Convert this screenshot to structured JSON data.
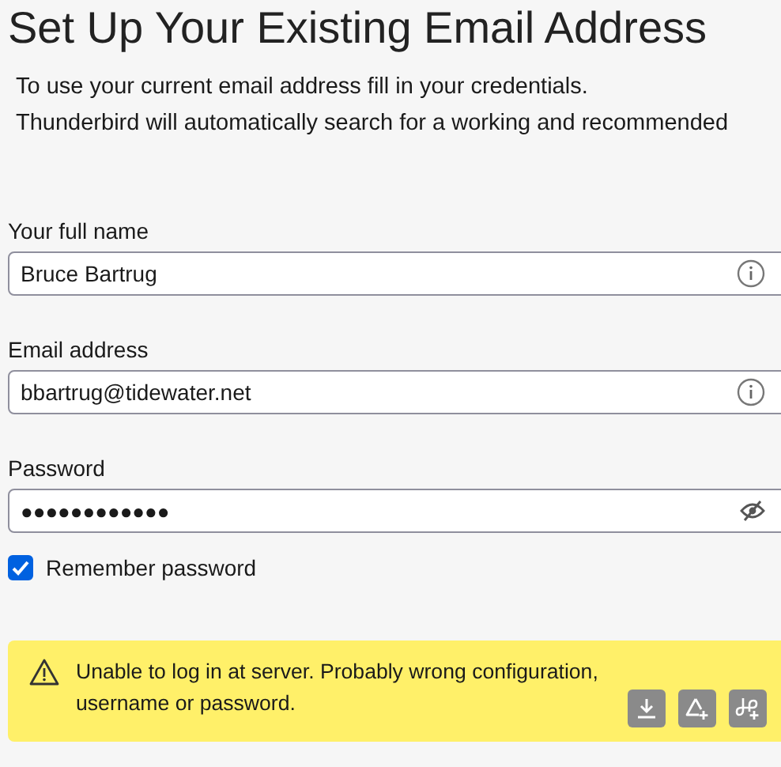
{
  "title": "Set Up Your Existing Email Address",
  "intro": [
    "To use your current email address fill in your credentials.",
    "Thunderbird will automatically search for a working and recommended"
  ],
  "fields": [
    {
      "label": "Your full name",
      "value": "Bruce Bartrug",
      "kind": "info"
    },
    {
      "label": "Email address",
      "value": "bbartrug@tidewater.net",
      "kind": "info"
    },
    {
      "label": "Password",
      "value": "●●●●●●●●●●●●",
      "kind": "password"
    }
  ],
  "remember": {
    "label": "Remember password",
    "checked": true
  },
  "notification": {
    "message": "Unable to log in at server. Probably wrong configuration, username or password.",
    "actions": [
      {
        "kind": "download"
      },
      {
        "kind": "add-alert"
      },
      {
        "kind": "add-link"
      }
    ]
  }
}
